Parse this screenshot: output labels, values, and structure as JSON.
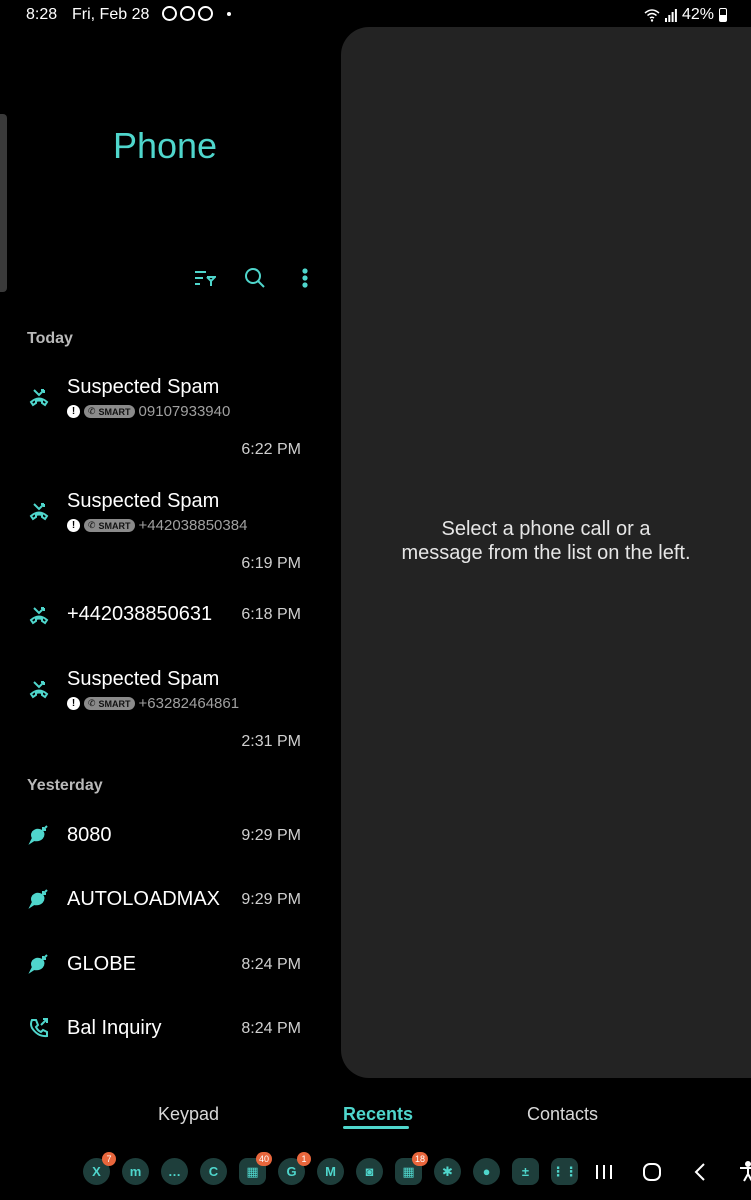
{
  "status_bar": {
    "time": "8:28",
    "date": "Fri, Feb 28",
    "battery": "42%"
  },
  "app": {
    "title": "Phone"
  },
  "toolbar": {
    "icons": [
      "filter-icon",
      "search-icon",
      "more-icon"
    ]
  },
  "sections": [
    {
      "header": "Today",
      "calls": [
        {
          "name": "Suspected Spam",
          "badge": "SMART",
          "number": "09107933940",
          "time": "6:22 PM",
          "type": "missed"
        },
        {
          "name": "Suspected Spam",
          "badge": "SMART",
          "number": "+442038850384",
          "time": "6:19 PM",
          "type": "missed"
        },
        {
          "name": "+442038850631",
          "time": "6:18 PM",
          "type": "missed"
        },
        {
          "name": "Suspected Spam",
          "badge": "SMART",
          "number": "+63282464861",
          "time": "2:31 PM",
          "type": "missed"
        }
      ]
    },
    {
      "header": "Yesterday",
      "calls": [
        {
          "name": "8080",
          "time": "9:29 PM",
          "type": "message"
        },
        {
          "name": "AUTOLOADMAX",
          "time": "9:29 PM",
          "type": "message"
        },
        {
          "name": "GLOBE",
          "time": "8:24 PM",
          "type": "message"
        },
        {
          "name": "Bal Inquiry",
          "time": "8:24 PM",
          "type": "outgoing"
        }
      ]
    }
  ],
  "detail": {
    "empty_text": "Select a phone call or a message from the list on the left."
  },
  "tabs": [
    {
      "label": "Keypad",
      "active": false
    },
    {
      "label": "Recents",
      "active": true
    },
    {
      "label": "Contacts",
      "active": false
    }
  ],
  "dock": [
    {
      "name": "x",
      "glyph": "X",
      "badge": "7"
    },
    {
      "name": "messenger",
      "glyph": "m",
      "badge": ""
    },
    {
      "name": "messages",
      "glyph": "…",
      "badge": ""
    },
    {
      "name": "phone",
      "glyph": "C",
      "badge": ""
    },
    {
      "name": "app-folder",
      "glyph": "▦",
      "badge": "40"
    },
    {
      "name": "google",
      "glyph": "G",
      "badge": "1"
    },
    {
      "name": "gmail",
      "glyph": "M",
      "badge": ""
    },
    {
      "name": "camera",
      "glyph": "◙",
      "badge": ""
    },
    {
      "name": "apps-folder-2",
      "glyph": "▦",
      "badge": "18"
    },
    {
      "name": "bixby",
      "glyph": "✱",
      "badge": ""
    },
    {
      "name": "assistant",
      "glyph": "●",
      "badge": ""
    },
    {
      "name": "calculator",
      "glyph": "±",
      "badge": ""
    },
    {
      "name": "app-drawer",
      "glyph": "⋮⋮",
      "badge": ""
    }
  ]
}
